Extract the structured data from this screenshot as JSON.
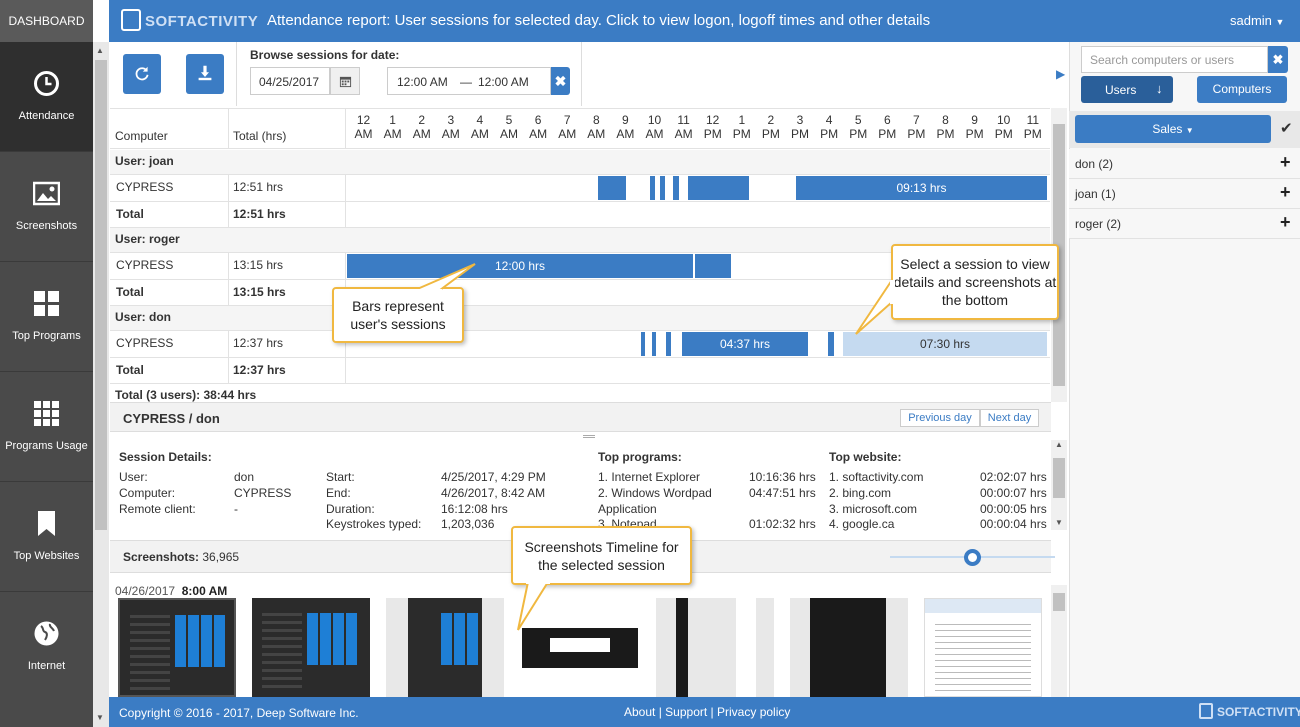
{
  "nav": {
    "dashboard_label": "DASHBOARD",
    "items": [
      {
        "label": "Attendance",
        "icon": "clock-icon"
      },
      {
        "label": "Screenshots",
        "icon": "image-icon"
      },
      {
        "label": "Top Programs",
        "icon": "windows-icon"
      },
      {
        "label": "Programs Usage",
        "icon": "grid-icon"
      },
      {
        "label": "Top Websites",
        "icon": "bookmark-icon"
      },
      {
        "label": "Internet",
        "icon": "globe-icon"
      }
    ]
  },
  "header": {
    "logo_text": "SOFTACTIVITY",
    "title": "Attendance report: User sessions for selected day. Click to view logon, logoff times and other details",
    "user": "sadmin"
  },
  "toolbar": {
    "browse_label": "Browse sessions for date:",
    "date_value": "04/25/2017",
    "time_from": "12:00 AM",
    "time_sep": "—",
    "time_to": "12:00 AM"
  },
  "table": {
    "col_computer": "Computer",
    "col_total": "Total (hrs)",
    "hours": [
      {
        "h": "12",
        "p": "AM"
      },
      {
        "h": "1",
        "p": "AM"
      },
      {
        "h": "2",
        "p": "AM"
      },
      {
        "h": "3",
        "p": "AM"
      },
      {
        "h": "4",
        "p": "AM"
      },
      {
        "h": "5",
        "p": "AM"
      },
      {
        "h": "6",
        "p": "AM"
      },
      {
        "h": "7",
        "p": "AM"
      },
      {
        "h": "8",
        "p": "AM"
      },
      {
        "h": "9",
        "p": "AM"
      },
      {
        "h": "10",
        "p": "AM"
      },
      {
        "h": "11",
        "p": "AM"
      },
      {
        "h": "12",
        "p": "PM"
      },
      {
        "h": "1",
        "p": "PM"
      },
      {
        "h": "2",
        "p": "PM"
      },
      {
        "h": "3",
        "p": "PM"
      },
      {
        "h": "4",
        "p": "PM"
      },
      {
        "h": "5",
        "p": "PM"
      },
      {
        "h": "6",
        "p": "PM"
      },
      {
        "h": "7",
        "p": "PM"
      },
      {
        "h": "8",
        "p": "PM"
      },
      {
        "h": "9",
        "p": "PM"
      },
      {
        "h": "10",
        "p": "PM"
      },
      {
        "h": "11",
        "p": "PM"
      }
    ],
    "groups": [
      {
        "user": "User: joan",
        "computer": "CYPRESS",
        "hours": "12:51 hrs",
        "total_label": "Total",
        "total": "12:51 hrs",
        "bar_label": "09:13 hrs"
      },
      {
        "user": "User: roger",
        "computer": "CYPRESS",
        "hours": "13:15 hrs",
        "total_label": "Total",
        "total": "13:15 hrs",
        "bar_label": "12:00 hrs"
      },
      {
        "user": "User: don",
        "computer": "CYPRESS",
        "hours": "12:37 hrs",
        "total_label": "Total",
        "total": "12:37 hrs",
        "bar_label_1": "04:37 hrs",
        "bar_label_2": "07:30 hrs"
      }
    ],
    "grand_total": "Total (3 users): 38:44 hrs"
  },
  "callouts": {
    "bars": "Bars represent user's sessions",
    "select": "Select a session to view details and screenshots at the bottom",
    "timeline": "Screenshots Timeline for the selected session"
  },
  "details": {
    "heading": "CYPRESS / don",
    "prev_day": "Previous day",
    "next_day": "Next day",
    "session_title": "Session Details:",
    "user_label": "User:",
    "user_value": "don",
    "computer_label": "Computer:",
    "computer_value": "CYPRESS",
    "remote_label": "Remote client:",
    "remote_value": "-",
    "start_label": "Start:",
    "start_value": "4/25/2017, 4:29 PM",
    "end_label": "End:",
    "end_value": "4/26/2017, 8:42 AM",
    "duration_label": "Duration:",
    "duration_value": "16:12:08 hrs",
    "keys_label": "Keystrokes typed:",
    "keys_value": "1,203,036",
    "programs_title": "Top programs:",
    "programs": [
      {
        "name": "1. Internet Explorer",
        "time": "10:16:36 hrs"
      },
      {
        "name": "2. Windows Wordpad",
        "time": "04:47:51 hrs"
      },
      {
        "name": "Application",
        "time": ""
      },
      {
        "name": "3. Notepad",
        "time": "01:02:32 hrs"
      }
    ],
    "websites_title": "Top website:",
    "websites": [
      {
        "name": "1. softactivity.com",
        "time": "02:02:07 hrs"
      },
      {
        "name": "2. bing.com",
        "time": "00:00:07 hrs"
      },
      {
        "name": "3. microsoft.com",
        "time": "00:00:05 hrs"
      },
      {
        "name": "4. google.ca",
        "time": "00:00:04 hrs"
      }
    ]
  },
  "screenshots": {
    "label": "Screenshots:",
    "count": "36,965",
    "date": "04/26/2017",
    "time": "8:00 AM"
  },
  "right_panel": {
    "search_placeholder": "Search computers or users",
    "users_btn": "Users",
    "computers_btn": "Computers",
    "group": "Sales",
    "users": [
      "don (2)",
      "joan (1)",
      "roger (2)"
    ]
  },
  "footer": {
    "copyright": "Copyright © 2016 - 2017, Deep Software Inc.",
    "about": "About",
    "support": "Support",
    "privacy": "Privacy policy",
    "sep": "|",
    "logo": "SOFTACTIVITY"
  },
  "colors": {
    "accent": "#3b7cc4",
    "nav": "#4a4a4a",
    "callout_border": "#f0b840"
  }
}
